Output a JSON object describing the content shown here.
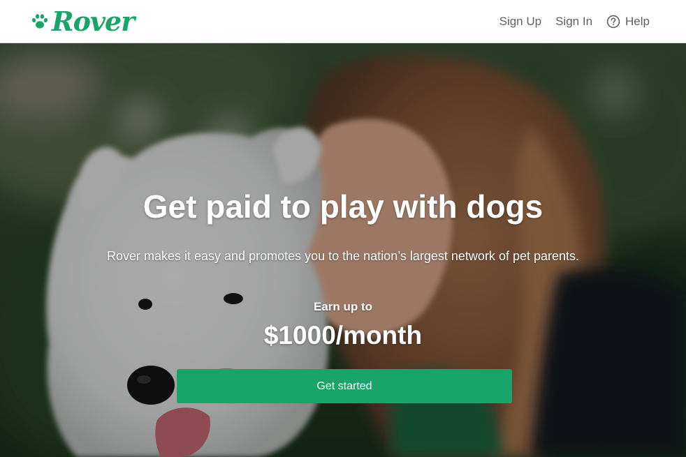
{
  "header": {
    "brand": "Rover",
    "brand_color": "#1aa568",
    "logo_icon": "paw-icon",
    "nav": {
      "sign_up": "Sign Up",
      "sign_in": "Sign In",
      "help": "Help",
      "help_icon": "question-circle-icon"
    }
  },
  "hero": {
    "title": "Get paid to play with dogs",
    "subtitle": "Rover makes it easy and promotes you to the nation’s largest network of pet parents.",
    "earn_label": "Earn up to",
    "earn_amount": "$1000/month",
    "cta_label": "Get started",
    "cta_color": "#1aa568",
    "background_image": "woman hugging white samoyed dog outdoors"
  }
}
